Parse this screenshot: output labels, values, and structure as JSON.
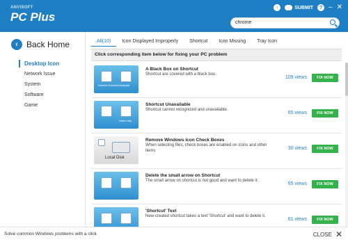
{
  "header": {
    "brand_small": "ANVISOFT",
    "brand_big": "PC Plus",
    "submit_label": "SUBMIT",
    "help_glyph": "?",
    "minimize_glyph": "–",
    "close_glyph": "✕",
    "search_value": "chrome"
  },
  "sidebar": {
    "back_label": "Back Home",
    "items": [
      "Desktop Icon",
      "Network Issue",
      "System",
      "Software",
      "Game"
    ]
  },
  "main": {
    "tabs": [
      "All(10)",
      "Icon Displayed Improperly",
      "Shortcut",
      "Icon Missing",
      "Tray Icon"
    ],
    "instruction": "Click corresponding item below for fixing your PC problem",
    "fix_label": "FIX NOW",
    "items": [
      {
        "title": "A Black Box on Shortcut",
        "desc": "Shortcut are covered with a black box.",
        "views": "109 views",
        "thumb_text_a": "Internet Explorer",
        "thumb_text_b": "Notepad"
      },
      {
        "title": "Shortcut Unavailable",
        "desc": "Shortcut cannot recognized and unavailable.",
        "views": "65 views",
        "thumb_text_a": "",
        "thumb_text_b": "Hello Kitty"
      },
      {
        "title": "Remove Windows Icon Check Boxes",
        "desc": "When selecting files, check boxes are enabled on icons and other items",
        "views": "30 views",
        "thumb_text_a": "Local Disk",
        "thumb_text_b": ""
      },
      {
        "title": "Delete the small arrow on Shortcut",
        "desc": "The small arrow on shortcut is not good and want to delete it.",
        "views": "65 views",
        "thumb_text_a": "",
        "thumb_text_b": ""
      },
      {
        "title": "'Shortcut' Text",
        "desc": "New-created shortcut takes a text 'Shortcut' and want to delete it.",
        "views": "81 views",
        "thumb_text_a": "",
        "thumb_text_b": ""
      }
    ]
  },
  "footer": {
    "text": "Solve common Windows problems with a click",
    "close_label": "CLOSE"
  },
  "colors": {
    "accent": "#1f7fc4",
    "fix": "#36b24d"
  }
}
